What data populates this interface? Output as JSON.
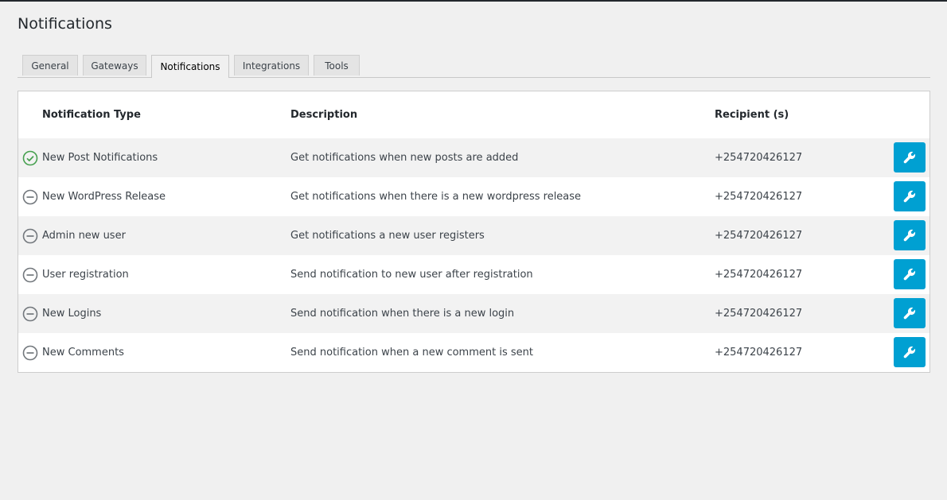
{
  "page": {
    "title": "Notifications"
  },
  "tabs": [
    {
      "label": "General",
      "active": false
    },
    {
      "label": "Gateways",
      "active": false
    },
    {
      "label": "Notifications",
      "active": true
    },
    {
      "label": "Integrations",
      "active": false
    },
    {
      "label": "Tools",
      "active": false
    }
  ],
  "table": {
    "headers": {
      "type": "Notification Type",
      "description": "Description",
      "recipient": "Recipient (s)"
    },
    "rows": [
      {
        "status": "enabled",
        "status_icon": "check-circle-icon",
        "type": "New Post Notifications",
        "description": "Get notifications when new posts are added",
        "recipient": "+254720426127"
      },
      {
        "status": "disabled",
        "status_icon": "minus-circle-icon",
        "type": "New WordPress Release",
        "description": "Get notifications when there is a new wordpress release",
        "recipient": "+254720426127"
      },
      {
        "status": "disabled",
        "status_icon": "minus-circle-icon",
        "type": "Admin new user",
        "description": "Get notifications a new user registers",
        "recipient": "+254720426127"
      },
      {
        "status": "disabled",
        "status_icon": "minus-circle-icon",
        "type": "User registration",
        "description": "Send notification to new user after registration",
        "recipient": "+254720426127"
      },
      {
        "status": "disabled",
        "status_icon": "minus-circle-icon",
        "type": "New Logins",
        "description": "Send notification when there is a new login",
        "recipient": "+254720426127"
      },
      {
        "status": "disabled",
        "status_icon": "minus-circle-icon",
        "type": "New Comments",
        "description": "Send notification when a new comment is sent",
        "recipient": "+254720426127"
      }
    ],
    "edit_icon": "wrench-icon"
  },
  "colors": {
    "accent": "#00a0d2",
    "enabled": "#46a04f",
    "disabled": "#72777c"
  }
}
